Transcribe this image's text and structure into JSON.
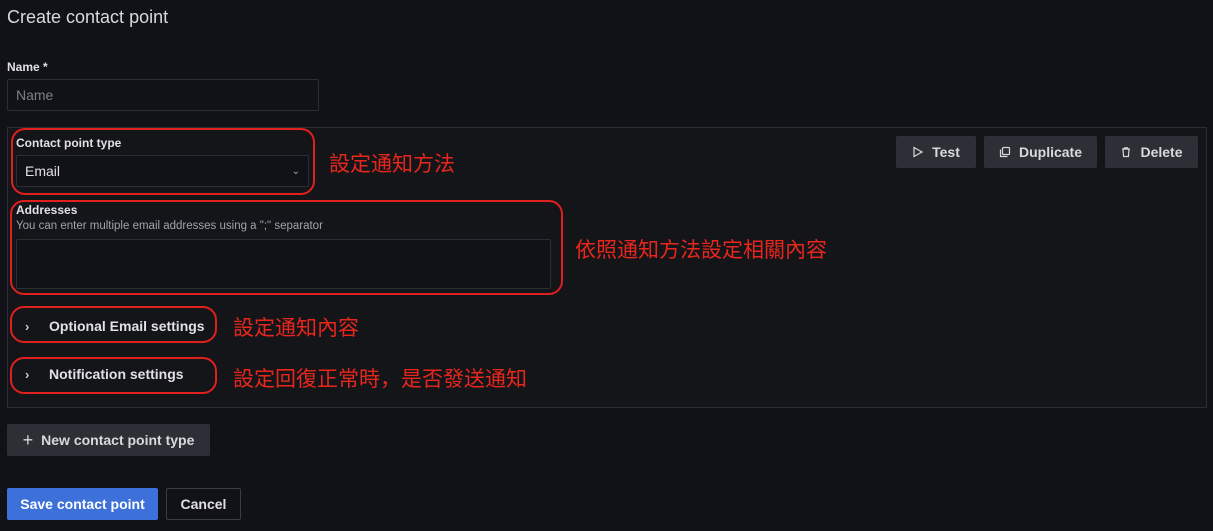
{
  "page": {
    "title": "Create contact point"
  },
  "name_field": {
    "label": "Name *",
    "placeholder": "Name",
    "value": ""
  },
  "contact_type": {
    "label": "Contact point type",
    "selected": "Email"
  },
  "addresses": {
    "label": "Addresses",
    "description": "You can enter multiple email addresses using a \";\" separator",
    "value": ""
  },
  "sections": {
    "optional_email": "Optional Email settings",
    "notification": "Notification settings"
  },
  "actions": {
    "test": "Test",
    "duplicate": "Duplicate",
    "delete": "Delete"
  },
  "new_type_button": "New contact point type",
  "footer": {
    "save": "Save contact point",
    "cancel": "Cancel"
  },
  "annotations": {
    "type": "設定通知方法",
    "addresses": "依照通知方法設定相關內容",
    "optional": "設定通知內容",
    "notification": "設定回復正常時，是否發送通知"
  },
  "colors": {
    "annotation": "#e01f1f",
    "primary": "#3d71d9",
    "background": "#111217"
  },
  "icons": {
    "select_chevron": "chevron-down-icon",
    "test": "play-icon",
    "duplicate": "copy-icon",
    "delete": "trash-icon",
    "collapse": "chevron-right-icon",
    "add": "plus-icon"
  }
}
